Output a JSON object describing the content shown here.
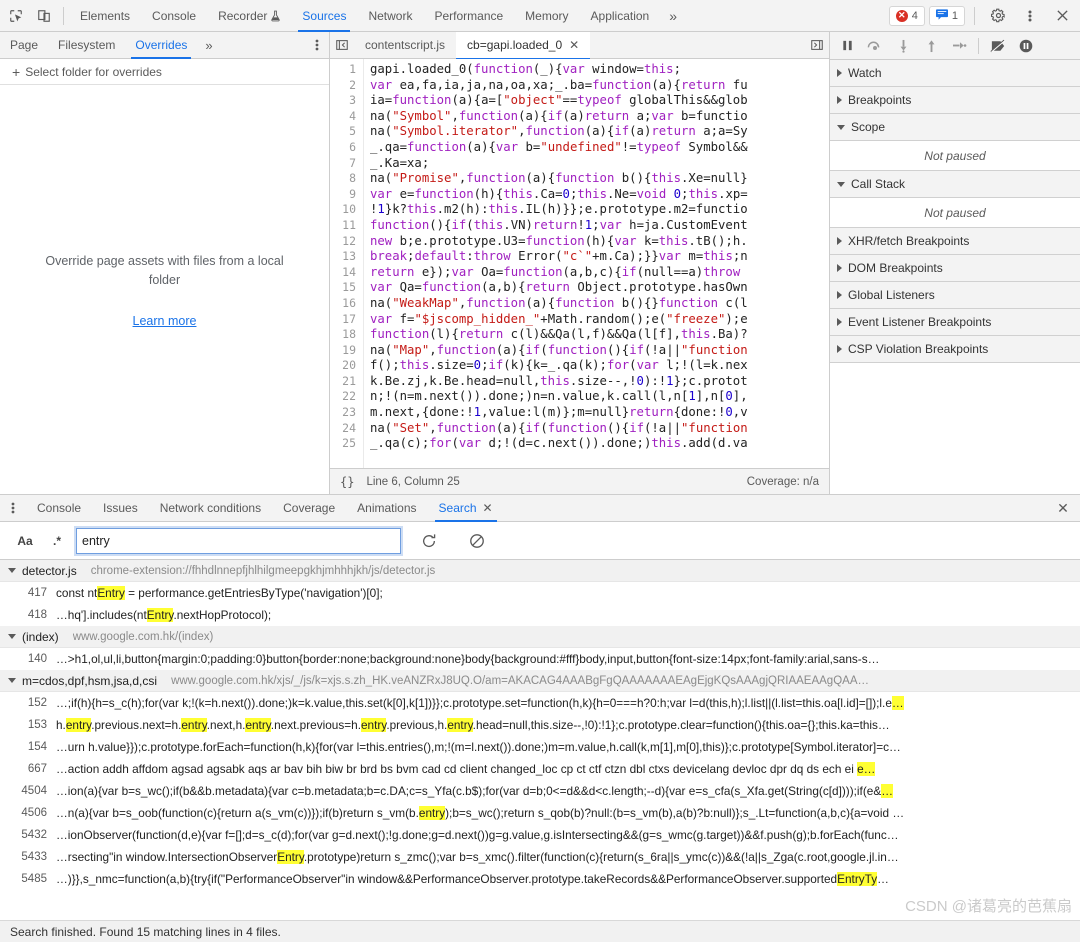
{
  "main_toolbar": {
    "icons": [
      {
        "name": "inspect-element-icon",
        "glyph": "cursor-box"
      },
      {
        "name": "device-toolbar-icon",
        "glyph": "device"
      }
    ],
    "tabs": [
      {
        "label": "Elements",
        "active": false
      },
      {
        "label": "Console",
        "active": false
      },
      {
        "label": "Recorder",
        "active": false,
        "badge": "flask"
      },
      {
        "label": "Sources",
        "active": true
      },
      {
        "label": "Network",
        "active": false
      },
      {
        "label": "Performance",
        "active": false
      },
      {
        "label": "Memory",
        "active": false
      },
      {
        "label": "Application",
        "active": false
      }
    ],
    "more_tabs": "»",
    "error_count": "4",
    "message_count": "1",
    "settings_icon": "gear-icon",
    "kebab_icon": "more-options-icon",
    "close_icon": "close-icon"
  },
  "navigator": {
    "tabs": [
      {
        "label": "Page",
        "active": false
      },
      {
        "label": "Filesystem",
        "active": false
      },
      {
        "label": "Overrides",
        "active": true
      }
    ],
    "more": "»",
    "select_folder_label": "Select folder for overrides",
    "empty_text": "Override page assets with files from a local folder",
    "learn_more": "Learn more"
  },
  "editor": {
    "tabs": [
      {
        "label": "contentscript.js",
        "active": false,
        "closable": false
      },
      {
        "label": "cb=gapi.loaded_0",
        "active": true,
        "closable": true
      }
    ],
    "status": {
      "format_icon": "{}",
      "position": "Line 6, Column 25",
      "coverage": "Coverage: n/a"
    },
    "code_lines": [
      {
        "n": 1,
        "text": "gapi.loaded_0(function(_){var window=this;"
      },
      {
        "n": 2,
        "text": "var ea,fa,ia,ja,na,oa,xa;_.ba=function(a){return fu"
      },
      {
        "n": 3,
        "text": "ia=function(a){a=[\"object\"==typeof globalThis&&glob"
      },
      {
        "n": 4,
        "text": "na(\"Symbol\",function(a){if(a)return a;var b=functio"
      },
      {
        "n": 5,
        "text": "na(\"Symbol.iterator\",function(a){if(a)return a;a=Sy"
      },
      {
        "n": 6,
        "text": "_.qa=function(a){var b=\"undefined\"!=typeof Symbol&&"
      },
      {
        "n": 7,
        "text": "_.Ka=xa;"
      },
      {
        "n": 8,
        "text": "na(\"Promise\",function(a){function b(){this.Xe=null}"
      },
      {
        "n": 9,
        "text": "var e=function(h){this.Ca=0;this.Ne=void 0;this.xp="
      },
      {
        "n": 10,
        "text": "!1}k?this.m2(h):this.IL(h)}};e.prototype.m2=functio"
      },
      {
        "n": 11,
        "text": "function(){if(this.VN)return!1;var h=ja.CustomEvent"
      },
      {
        "n": 12,
        "text": "new b;e.prototype.U3=function(h){var k=this.tB();h."
      },
      {
        "n": 13,
        "text": "break;default:throw Error(\"c`\"+m.Ca);}}var m=this;n"
      },
      {
        "n": 14,
        "text": "return e});var Oa=function(a,b,c){if(null==a)throw "
      },
      {
        "n": 15,
        "text": "var Qa=function(a,b){return Object.prototype.hasOwn"
      },
      {
        "n": 16,
        "text": "na(\"WeakMap\",function(a){function b(){}function c(l"
      },
      {
        "n": 17,
        "text": "var f=\"$jscomp_hidden_\"+Math.random();e(\"freeze\");e"
      },
      {
        "n": 18,
        "text": "function(l){return c(l)&&Qa(l,f)&&Qa(l[f],this.Ba)?"
      },
      {
        "n": 19,
        "text": "na(\"Map\",function(a){if(function(){if(!a||\"function"
      },
      {
        "n": 20,
        "text": "f();this.size=0;if(k){k=_.qa(k);for(var l;!(l=k.nex"
      },
      {
        "n": 21,
        "text": "k.Be.zj,k.Be.head=null,this.size--,!0):!1};c.protot"
      },
      {
        "n": 22,
        "text": "n;!(n=m.next()).done;)n=n.value,k.call(l,n[1],n[0],"
      },
      {
        "n": 23,
        "text": "m.next,{done:!1,value:l(m)};m=null}return{done:!0,v"
      },
      {
        "n": 24,
        "text": "na(\"Set\",function(a){if(function(){if(!a||\"function"
      },
      {
        "n": 25,
        "text": "_.qa(c);for(var d;!(d=c.next()).done;)this.add(d.va"
      }
    ]
  },
  "debugger": {
    "toolbar_icons": [
      {
        "name": "resume-script-icon"
      },
      {
        "name": "step-over-icon"
      },
      {
        "name": "step-into-icon"
      },
      {
        "name": "step-out-icon"
      },
      {
        "name": "step-icon"
      },
      {
        "name": "deactivate-breakpoints-icon"
      },
      {
        "name": "pause-on-exceptions-icon"
      }
    ],
    "sections": [
      {
        "label": "Watch",
        "expanded": false,
        "body": null
      },
      {
        "label": "Breakpoints",
        "expanded": false,
        "body": null
      },
      {
        "label": "Scope",
        "expanded": true,
        "body": "Not paused"
      },
      {
        "label": "Call Stack",
        "expanded": true,
        "body": "Not paused"
      },
      {
        "label": "XHR/fetch Breakpoints",
        "expanded": false,
        "body": null
      },
      {
        "label": "DOM Breakpoints",
        "expanded": false,
        "body": null
      },
      {
        "label": "Global Listeners",
        "expanded": false,
        "body": null
      },
      {
        "label": "Event Listener Breakpoints",
        "expanded": false,
        "body": null
      },
      {
        "label": "CSP Violation Breakpoints",
        "expanded": false,
        "body": null
      }
    ]
  },
  "drawer": {
    "tabs": [
      {
        "label": "Console",
        "active": false,
        "closable": false
      },
      {
        "label": "Issues",
        "active": false,
        "closable": false
      },
      {
        "label": "Network conditions",
        "active": false,
        "closable": false
      },
      {
        "label": "Coverage",
        "active": false,
        "closable": false
      },
      {
        "label": "Animations",
        "active": false,
        "closable": false
      },
      {
        "label": "Search",
        "active": true,
        "closable": true
      }
    ],
    "close_icon": "close-drawer-icon"
  },
  "search": {
    "match_case_label": "Aa",
    "regex_label": ".*",
    "query": "entry",
    "placeholder": "",
    "refresh_icon": "refresh-icon",
    "clear_icon": "clear-icon",
    "status": "Search finished. Found 15 matching lines in 4 files."
  },
  "search_results": [
    {
      "file": "detector.js",
      "url": "chrome-extension://fhhdlnnepfjhlhilgmeepgkhjmhhhjkh/js/detector.js",
      "expanded": true,
      "lines": [
        {
          "num": "417",
          "parts": [
            {
              "t": "const nt",
              "hl": false
            },
            {
              "t": "Entry",
              "hl": true
            },
            {
              "t": " = performance.getEntriesByType('navigation')[0];",
              "hl": false
            }
          ]
        },
        {
          "num": "418",
          "parts": [
            {
              "t": "…hq'].includes(nt",
              "hl": false
            },
            {
              "t": "Entry",
              "hl": true
            },
            {
              "t": ".nextHopProtocol);",
              "hl": false
            }
          ]
        }
      ]
    },
    {
      "file": "(index)",
      "url": "www.google.com.hk/(index)",
      "expanded": true,
      "lines": [
        {
          "num": "140",
          "parts": [
            {
              "t": "…>h1,ol,ul,li,button{margin:0;padding:0}button{border:none;background:none}body{background:#fff}body,input,button{font-size:14px;font-family:arial,sans-s…",
              "hl": false
            }
          ]
        }
      ]
    },
    {
      "file": "m=cdos,dpf,hsm,jsa,d,csi",
      "url": "www.google.com.hk/xjs/_/js/k=xjs.s.zh_HK.veANZRxJ8UQ.O/am=AKACAG4AAABgFgQAAAAAAAEAgEjgKQsAAAgjQRIAAEAAgQAA…",
      "expanded": true,
      "lines": [
        {
          "num": "152",
          "parts": [
            {
              "t": "…;if(h){h=s_c(h);for(var k;!(k=h.next()).done;)k=k.value,this.set(k[0],k[1])}};c.prototype.set=function(h,k){h=0===h?0:h;var l=d(this,h);l.list||(l.list=this.oa[l.id]=[]);l.e",
              "hl": false
            },
            {
              "t": "…",
              "hl": true
            }
          ]
        },
        {
          "num": "153",
          "parts": [
            {
              "t": "h.",
              "hl": false
            },
            {
              "t": "entry",
              "hl": true
            },
            {
              "t": ".previous.next=h.",
              "hl": false
            },
            {
              "t": "entry",
              "hl": true
            },
            {
              "t": ".next,h.",
              "hl": false
            },
            {
              "t": "entry",
              "hl": true
            },
            {
              "t": ".next.previous=h.",
              "hl": false
            },
            {
              "t": "entry",
              "hl": true
            },
            {
              "t": ".previous,h.",
              "hl": false
            },
            {
              "t": "entry",
              "hl": true
            },
            {
              "t": ".head=null,this.size--,!0):!1};c.prototype.clear=function(){this.oa={};this.ka=this…",
              "hl": false
            }
          ]
        },
        {
          "num": "154",
          "parts": [
            {
              "t": "…urn h.value}});c.prototype.forEach=function(h,k){for(var l=this.entries(),m;!(m=l.next()).done;)m=m.value,h.call(k,m[1],m[0],this)};c.prototype[Symbol.iterator]=c…",
              "hl": false
            }
          ]
        },
        {
          "num": "667",
          "parts": [
            {
              "t": "…action addh affdom agsad agsabk aqs ar bav bih biw br brd bs bvm cad cd client changed_loc cp ct ctf ctzn dbl ctxs devicelang devloc dpr dq ds ech ei ",
              "hl": false
            },
            {
              "t": "e…",
              "hl": true
            }
          ]
        },
        {
          "num": "4504",
          "parts": [
            {
              "t": "…ion(a){var b=s_wc();if(b&&b.metadata){var c=b.metadata;b=c.DA;c=s_Yfa(c.b$);for(var d=b;0<=d&&d<c.length;--d){var e=s_cfa(s_Xfa.get(String(c[d])));if(e&",
              "hl": false
            },
            {
              "t": "…",
              "hl": true
            }
          ]
        },
        {
          "num": "4506",
          "parts": [
            {
              "t": "…n(a){var b=s_oob(function(c){return a(s_vm(c))});if(b)return s_vm(b.",
              "hl": false
            },
            {
              "t": "entry",
              "hl": true
            },
            {
              "t": ");b=s_wc();return s_qob(b)?null:(b=s_vm(b),a(b)?b:null)};s_.Lt=function(a,b,c){a=void …",
              "hl": false
            }
          ]
        },
        {
          "num": "5432",
          "parts": [
            {
              "t": "…ionObserver(function(d,e){var f=[];d=s_c(d);for(var g=d.next();!g.done;g=d.next())g=g.value,g.isIntersecting&&(g=s_wmc(g.target))&&f.push(g);b.forEach(func…",
              "hl": false
            }
          ]
        },
        {
          "num": "5433",
          "parts": [
            {
              "t": "…rsecting\"in window.IntersectionObserver",
              "hl": false
            },
            {
              "t": "Entry",
              "hl": true
            },
            {
              "t": ".prototype)return s_zmc();var b=s_xmc().filter(function(c){return(s_6ra||s_ymc(c))&&(!a||s_Zga(c.root,google.jl.in…",
              "hl": false
            }
          ]
        },
        {
          "num": "5485",
          "parts": [
            {
              "t": "…)}},s_nmc=function(a,b){try{if(\"PerformanceObserver\"in window&&PerformanceObserver.prototype.takeRecords&&PerformanceObserver.supported",
              "hl": false
            },
            {
              "t": "EntryTy",
              "hl": true
            },
            {
              "t": "…",
              "hl": false
            }
          ]
        }
      ]
    }
  ],
  "watermark": "CSDN @诸葛亮的芭蕉扇",
  "colors": {
    "accent": "#1a73e8",
    "toolbar_bg": "#f3f3f3",
    "border": "#cdcdcd",
    "highlight": "#ffff33",
    "error_red": "#d93025",
    "keyword": "#a020c0",
    "string": "#c41a16",
    "number": "#1c00cf"
  }
}
